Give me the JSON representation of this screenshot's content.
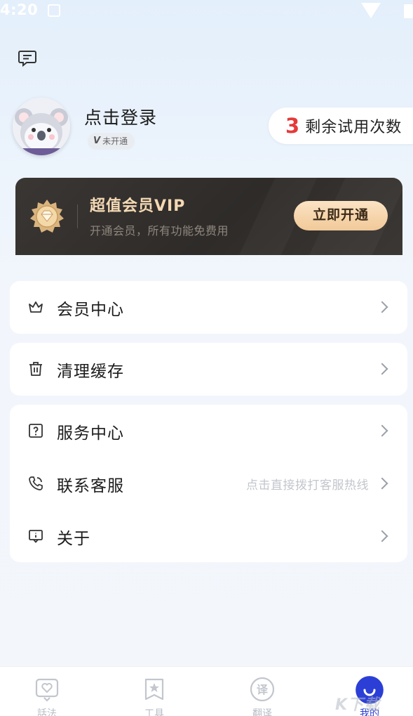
{
  "status_bar": {
    "time": "4:20"
  },
  "profile": {
    "login_text": "点击登录",
    "vip_status": "未开通",
    "vip_letter": "V",
    "trial_count": "3",
    "trial_label": "剩余试用次数"
  },
  "vip_banner": {
    "title": "超值会员VIP",
    "subtitle": "开通会员，所有功能免费用",
    "button": "立即开通",
    "colors": {
      "accent": "#f4d9b4",
      "background": "#2e2b29"
    }
  },
  "menu": {
    "member_center": {
      "label": "会员中心",
      "icon": "crown-icon"
    },
    "clear_cache": {
      "label": "清理缓存",
      "icon": "trash-icon"
    },
    "service_center": {
      "label": "服务中心",
      "icon": "question-icon"
    },
    "contact": {
      "label": "联系客服",
      "icon": "phone-icon",
      "hint": "点击直接拨打客服热线"
    },
    "about": {
      "label": "关于",
      "icon": "info-icon"
    }
  },
  "bottom_nav": {
    "items": [
      {
        "label": "話法",
        "icon": "chat-heart-icon"
      },
      {
        "label": "工具",
        "icon": "star-book-icon"
      },
      {
        "label": "翻译",
        "icon": "translate-icon",
        "glyph": "译"
      },
      {
        "label": "我的",
        "icon": "profile-icon"
      }
    ],
    "active_color": "#2b3fd6"
  },
  "watermark": "K下载"
}
